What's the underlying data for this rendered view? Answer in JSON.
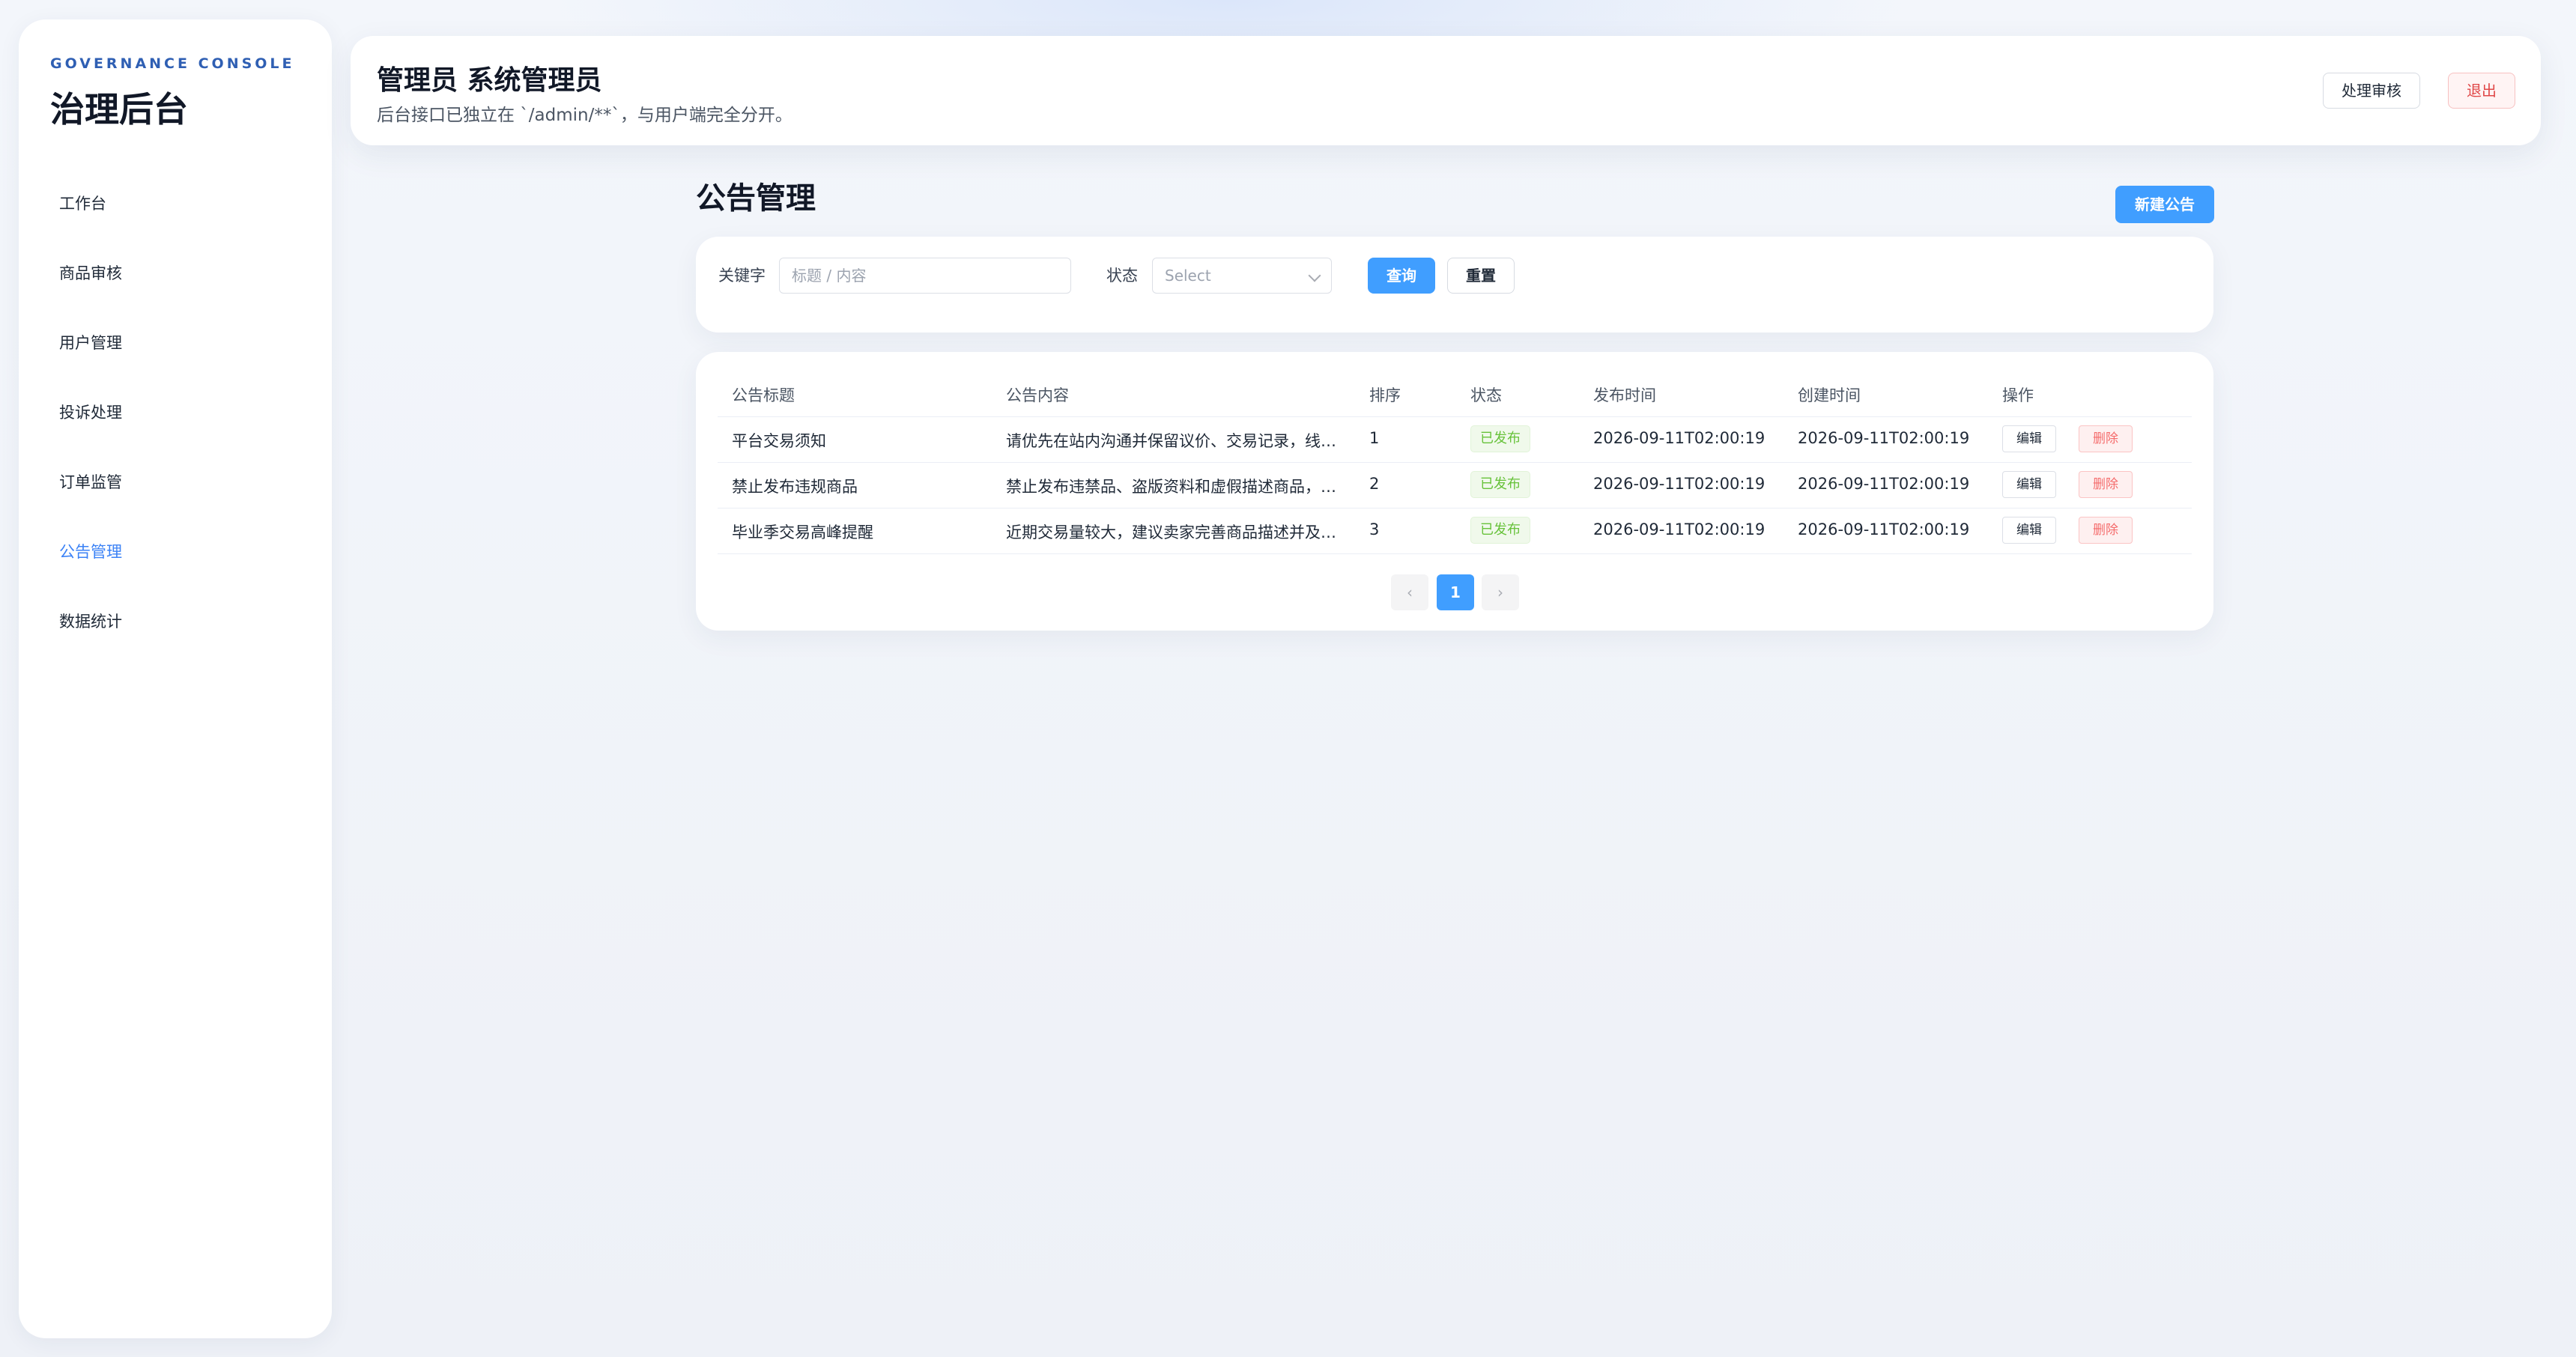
{
  "sidebar": {
    "eyebrow": "GOVERNANCE CONSOLE",
    "title": "治理后台",
    "items": [
      {
        "label": "工作台",
        "active": false
      },
      {
        "label": "商品审核",
        "active": false
      },
      {
        "label": "用户管理",
        "active": false
      },
      {
        "label": "投诉处理",
        "active": false
      },
      {
        "label": "订单监管",
        "active": false
      },
      {
        "label": "公告管理",
        "active": true
      },
      {
        "label": "数据统计",
        "active": false
      }
    ]
  },
  "header": {
    "title": "管理员 系统管理员",
    "subtitle": "后台接口已独立在 `/admin/**`，与用户端完全分开。",
    "review_label": "处理审核",
    "logout_label": "退出"
  },
  "page": {
    "title": "公告管理",
    "new_button": "新建公告"
  },
  "filter": {
    "keyword_label": "关键字",
    "keyword_placeholder": "标题 / 内容",
    "status_label": "状态",
    "status_placeholder": "Select",
    "query_label": "查询",
    "reset_label": "重置"
  },
  "table": {
    "columns": [
      "公告标题",
      "公告内容",
      "排序",
      "状态",
      "发布时间",
      "创建时间",
      "操作"
    ],
    "rows": [
      {
        "title": "平台交易须知",
        "content": "请优先在站内沟通并保留议价、交易记录，线…",
        "order": "1",
        "status": "已发布",
        "published": "2026-09-11T02:00:19",
        "created": "2026-09-11T02:00:19"
      },
      {
        "title": "禁止发布违规商品",
        "content": "禁止发布违禁品、盗版资料和虚假描述商品，…",
        "order": "2",
        "status": "已发布",
        "published": "2026-09-11T02:00:19",
        "created": "2026-09-11T02:00:19"
      },
      {
        "title": "毕业季交易高峰提醒",
        "content": "近期交易量较大，建议卖家完善商品描述并及…",
        "order": "3",
        "status": "已发布",
        "published": "2026-09-11T02:00:19",
        "created": "2026-09-11T02:00:19"
      }
    ],
    "edit_label": "编辑",
    "delete_label": "删除"
  },
  "pagination": {
    "prev": "‹",
    "current": "1",
    "next": "›"
  },
  "colors": {
    "accent": "#409eff",
    "success": "#67c23a",
    "danger": "#f56c6c"
  }
}
